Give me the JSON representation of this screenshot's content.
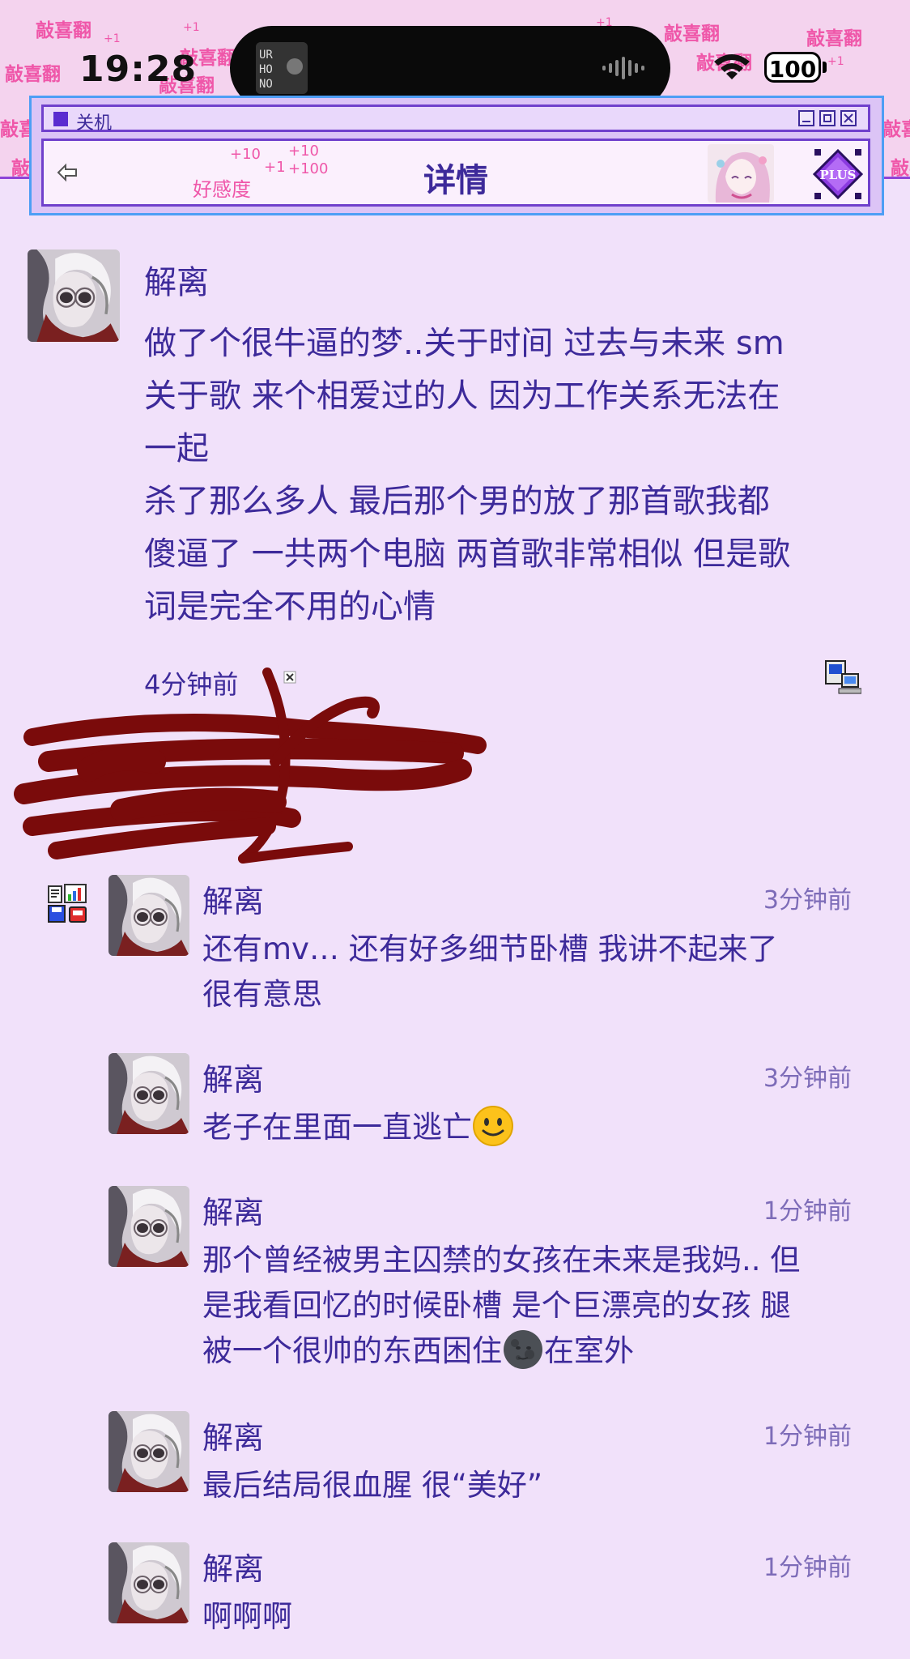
{
  "status": {
    "time": "19:28",
    "battery": "100"
  },
  "header": {
    "decor_text": "敲喜翻",
    "window_title": "关机",
    "page_title": "详情",
    "favor_label": "好感度",
    "favor_numbers": [
      "+10",
      "+10",
      "+1",
      "+100",
      "+1"
    ],
    "badge_text": "PLUS"
  },
  "post": {
    "author": "解离",
    "text": "做了个很牛逼的梦..关于时间 过去与未来 sm\n关于歌 来个相爱过的人 因为工作关系无法在\n一起\n杀了那么多人 最后那个男的放了那首歌我都\n傻逼了 一共两个电脑 两首歌非常相似 但是歌\n词是完全不用的心情",
    "time": "4分钟前"
  },
  "comments": [
    {
      "author": "解离",
      "time": "3分钟前",
      "text": "还有mv… 还有好多细节卧槽 我讲不起来了\n很有意思"
    },
    {
      "author": "解离",
      "time": "3分钟前",
      "text": "老子在里面一直逃亡",
      "emoji": "slightly-smiling-face"
    },
    {
      "author": "解离",
      "time": "1分钟前",
      "text_a": "那个曾经被男主囚禁的女孩在未来是我妈.. 但\n是我看回忆的时候卧槽 是个巨漂亮的女孩 腿\n被一个很帅的东西困住",
      "emoji": "new-moon-face",
      "text_b": "在室外"
    },
    {
      "author": "解离",
      "time": "1分钟前",
      "text": "最后结局很血腥 很“美好”"
    },
    {
      "author": "解离",
      "time": "1分钟前",
      "text": "啊啊啊"
    }
  ],
  "colors": {
    "background": "#f1e1fa",
    "text": "#3d2a9a",
    "accent_pink": "#ef57a9",
    "window_border": "#4d9ef5",
    "scribble": "#7a0b0b"
  }
}
